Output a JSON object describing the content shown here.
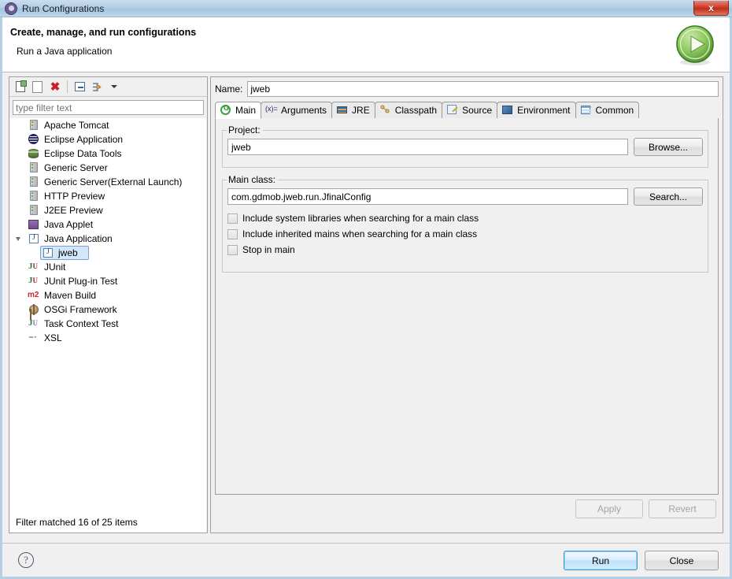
{
  "window": {
    "title": "Run Configurations",
    "icon": "run-configurations-gear-icon",
    "close_label": "x"
  },
  "header": {
    "title": "Create, manage, and run configurations",
    "subtitle": "Run a Java application",
    "run_icon": "green-run-play-icon"
  },
  "tree_toolbar": {
    "buttons": [
      {
        "name": "new-configuration",
        "icon": "new-document-icon"
      },
      {
        "name": "duplicate-configuration",
        "icon": "copy-icon"
      },
      {
        "name": "delete-configuration",
        "icon": "delete-red-x-icon",
        "glyph": "✖"
      },
      {
        "name": "collapse-all",
        "icon": "collapse-all-icon"
      },
      {
        "name": "filter-configurations",
        "icon": "filter-arrow-icon"
      },
      {
        "name": "view-menu",
        "icon": "chevron-down-icon"
      }
    ]
  },
  "filter": {
    "placeholder": "type filter text",
    "value": "",
    "status": "Filter matched 16 of 25 items"
  },
  "tree": {
    "items": [
      {
        "label": "Apache Tomcat",
        "icon": "server-icon",
        "indent": 0,
        "selected": false,
        "twisty": "none"
      },
      {
        "label": "Eclipse Application",
        "icon": "eclipse-icon",
        "indent": 0,
        "selected": false,
        "twisty": "none"
      },
      {
        "label": "Eclipse Data Tools",
        "icon": "database-icon",
        "indent": 0,
        "selected": false,
        "twisty": "none"
      },
      {
        "label": "Generic Server",
        "icon": "server-icon",
        "indent": 0,
        "selected": false,
        "twisty": "none"
      },
      {
        "label": "Generic Server(External Launch)",
        "icon": "server-icon",
        "indent": 0,
        "selected": false,
        "twisty": "none"
      },
      {
        "label": "HTTP Preview",
        "icon": "server-icon",
        "indent": 0,
        "selected": false,
        "twisty": "none"
      },
      {
        "label": "J2EE Preview",
        "icon": "server-icon",
        "indent": 0,
        "selected": false,
        "twisty": "none"
      },
      {
        "label": "Java Applet",
        "icon": "java-applet-icon",
        "indent": 0,
        "selected": false,
        "twisty": "none"
      },
      {
        "label": "Java Application",
        "icon": "java-application-icon",
        "indent": 0,
        "selected": false,
        "twisty": "open"
      },
      {
        "label": "jweb",
        "icon": "java-application-icon",
        "indent": 1,
        "selected": true,
        "twisty": "none"
      },
      {
        "label": "JUnit",
        "icon": "junit-icon",
        "indent": 0,
        "selected": false,
        "twisty": "none"
      },
      {
        "label": "JUnit Plug-in Test",
        "icon": "junit-plugin-icon",
        "indent": 0,
        "selected": false,
        "twisty": "none"
      },
      {
        "label": "Maven Build",
        "icon": "maven-m2-icon",
        "indent": 0,
        "selected": false,
        "twisty": "none"
      },
      {
        "label": "OSGi Framework",
        "icon": "osgi-icon",
        "indent": 0,
        "selected": false,
        "twisty": "none"
      },
      {
        "label": "Task Context Test",
        "icon": "task-context-test-icon",
        "indent": 0,
        "selected": false,
        "twisty": "none"
      },
      {
        "label": "XSL",
        "icon": "xsl-icon",
        "indent": 0,
        "selected": false,
        "twisty": "none"
      }
    ]
  },
  "config": {
    "name_label": "Name:",
    "name_value": "jweb",
    "tabs": [
      {
        "label": "Main",
        "icon": "main-tab-icon",
        "active": true
      },
      {
        "label": "Arguments",
        "icon": "arguments-tab-icon",
        "active": false
      },
      {
        "label": "JRE",
        "icon": "jre-tab-icon",
        "active": false
      },
      {
        "label": "Classpath",
        "icon": "classpath-tab-icon",
        "active": false
      },
      {
        "label": "Source",
        "icon": "source-tab-icon",
        "active": false
      },
      {
        "label": "Environment",
        "icon": "environment-tab-icon",
        "active": false
      },
      {
        "label": "Common",
        "icon": "common-tab-icon",
        "active": false
      }
    ],
    "project": {
      "legend": "Project:",
      "value": "jweb",
      "browse_label": "Browse..."
    },
    "main_class": {
      "legend": "Main class:",
      "value": "com.gdmob.jweb.run.JfinalConfig",
      "search_label": "Search...",
      "checkboxes": [
        {
          "label": "Include system libraries when searching for a main class",
          "checked": false
        },
        {
          "label": "Include inherited mains when searching for a main class",
          "checked": false
        },
        {
          "label": "Stop in main",
          "checked": false
        }
      ]
    },
    "apply_label": "Apply",
    "apply_enabled": false,
    "revert_label": "Revert",
    "revert_enabled": false
  },
  "footer": {
    "help_icon": "help-question-icon",
    "help_glyph": "?",
    "run_label": "Run",
    "close_label": "Close"
  },
  "colors": {
    "titlebar": "#b4cfe6",
    "dialog_bg": "#f0f0f0",
    "selection": "#d2e7fa",
    "selection_border": "#7da2ce",
    "close_red": "#d4452f",
    "run_green": "#5fa83d",
    "default_button_border": "#3c9bd4"
  }
}
